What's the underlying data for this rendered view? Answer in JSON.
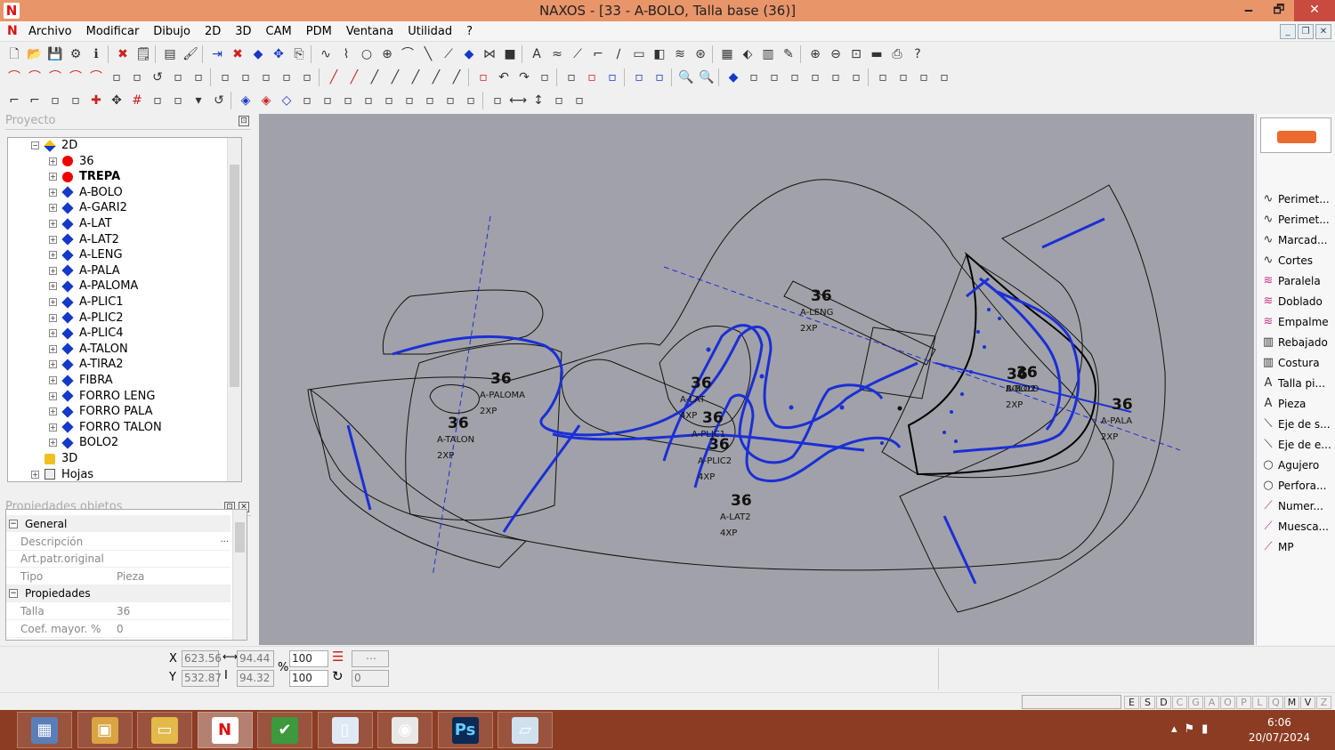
{
  "window": {
    "title": "NAXOS - [33 - A-BOLO, Talla base (36)]",
    "minimize": "🗕",
    "maximize": "🗗",
    "close": "✕"
  },
  "menu": [
    "Archivo",
    "Modificar",
    "Dibujo",
    "2D",
    "3D",
    "CAM",
    "PDM",
    "Ventana",
    "Utilidad",
    "?"
  ],
  "toolbar_icons": {
    "row1": [
      "new-file",
      "open-folder",
      "save",
      "gear",
      "info",
      "sep",
      "delete",
      "props",
      "sep",
      "layers",
      "color-picker",
      "sep",
      "insert",
      "delete-red",
      "mark",
      "move",
      "copy",
      "sep",
      "curve",
      "spline",
      "circle",
      "target",
      "arc",
      "line",
      "polyline",
      "point",
      "mirror",
      "square",
      "sep",
      "text",
      "wave",
      "measure",
      "corner",
      "slash",
      "rect",
      "bucket",
      "waves",
      "node",
      "sep",
      "piece",
      "arrange",
      "fill",
      "pin",
      "sep",
      "zoom-in",
      "zoom-out",
      "zoom-window",
      "ruler",
      "print",
      "help"
    ],
    "row2": [
      "arc1",
      "arc2",
      "arc3",
      "arc4",
      "arc5",
      "ellipse",
      "notch",
      "rotate",
      "dots",
      "grid",
      "sep",
      "copy2",
      "paste",
      "cut",
      "select",
      "arrows",
      "sep",
      "line-a",
      "line-b",
      "line-c",
      "line-d",
      "line-e",
      "line-f",
      "line-g",
      "sep",
      "cross",
      "undo-arrow",
      "redo-arrow",
      "wave2",
      "sep",
      "box",
      "scissors",
      "up-down",
      "sep",
      "arrow-r",
      "arrow-r2",
      "sep",
      "zoom-a",
      "zoom-b",
      "sep",
      "diamond",
      "slash2",
      "stack",
      "folder",
      "image",
      "shape",
      "shape2",
      "sep",
      "image2",
      "badge",
      "flip",
      "flip2"
    ],
    "row3": [
      "corner1",
      "corner2",
      "rect-a",
      "dotted-line",
      "cross-red",
      "move4",
      "hash-red",
      "align",
      "curve2",
      "dropdown",
      "rotate",
      "sep",
      "merge",
      "merge-red",
      "split",
      "pages",
      "down",
      "bars",
      "columns",
      "link",
      "chart",
      "chart2",
      "window",
      "asterisk",
      "sep",
      "measure2",
      "h-arrows",
      "v-arrows",
      "pointer",
      "compass"
    ]
  },
  "project_panel": {
    "title": "Proyecto",
    "pin": "⊡",
    "tree": [
      {
        "label": "2D",
        "level": 0,
        "marker": "yellow-diamond",
        "expand": "−"
      },
      {
        "label": "36",
        "level": 1,
        "marker": "red-dot",
        "expand": "+"
      },
      {
        "label": "TREPA",
        "level": 1,
        "marker": "red-dot",
        "expand": "+",
        "bold": true
      },
      {
        "label": "A-BOLO",
        "level": 1,
        "marker": "blue-diamond",
        "expand": "+"
      },
      {
        "label": "A-GARI2",
        "level": 1,
        "marker": "blue-diamond",
        "expand": "+"
      },
      {
        "label": "A-LAT",
        "level": 1,
        "marker": "blue-diamond",
        "expand": "+"
      },
      {
        "label": "A-LAT2",
        "level": 1,
        "marker": "blue-diamond",
        "expand": "+"
      },
      {
        "label": "A-LENG",
        "level": 1,
        "marker": "blue-diamond",
        "expand": "+"
      },
      {
        "label": "A-PALA",
        "level": 1,
        "marker": "blue-diamond",
        "expand": "+"
      },
      {
        "label": "A-PALOMA",
        "level": 1,
        "marker": "blue-diamond",
        "expand": "+"
      },
      {
        "label": "A-PLIC1",
        "level": 1,
        "marker": "blue-diamond",
        "expand": "+"
      },
      {
        "label": "A-PLIC2",
        "level": 1,
        "marker": "blue-diamond",
        "expand": "+"
      },
      {
        "label": "A-PLIC4",
        "level": 1,
        "marker": "blue-diamond",
        "expand": "+"
      },
      {
        "label": "A-TALON",
        "level": 1,
        "marker": "blue-diamond",
        "expand": "+"
      },
      {
        "label": "A-TIRA2",
        "level": 1,
        "marker": "blue-diamond",
        "expand": "+"
      },
      {
        "label": "FIBRA",
        "level": 1,
        "marker": "blue-diamond",
        "expand": "+"
      },
      {
        "label": "FORRO LENG",
        "level": 1,
        "marker": "blue-diamond",
        "expand": "+"
      },
      {
        "label": "FORRO PALA",
        "level": 1,
        "marker": "blue-diamond",
        "expand": "+"
      },
      {
        "label": "FORRO TALON",
        "level": 1,
        "marker": "blue-diamond",
        "expand": "+"
      },
      {
        "label": "BOLO2",
        "level": 1,
        "marker": "blue-diamond",
        "expand": "+"
      },
      {
        "label": "3D",
        "level": 0,
        "marker": "yellow-cube",
        "expand": ""
      },
      {
        "label": "Hojas",
        "level": 0,
        "marker": "sheets",
        "expand": "+"
      }
    ]
  },
  "properties_panel": {
    "title": "Propiedades objetos",
    "sections": [
      {
        "label": "General",
        "expand": "−",
        "rows": [
          {
            "key": "Descripción",
            "value": "",
            "button": "..."
          },
          {
            "key": "Art.patr.original",
            "value": ""
          },
          {
            "key": "Tipo",
            "value": "Pieza"
          }
        ]
      },
      {
        "label": "Propiedades",
        "expand": "−",
        "rows": [
          {
            "key": "Talla",
            "value": "36"
          },
          {
            "key": "Coef. mayor. %",
            "value": "0"
          }
        ]
      }
    ]
  },
  "canvas": {
    "background": "#a1a1a9",
    "outline_color": "#111111",
    "seam_color": "#1a2fd6",
    "labels": [
      {
        "size": "36",
        "name": "A-PALOMA",
        "qty": "2XP"
      },
      {
        "size": "36",
        "name": "A-TALON",
        "qty": "2XP"
      },
      {
        "size": "36",
        "name": "A-LAT",
        "qty": "4XP"
      },
      {
        "size": "36",
        "name": "A-PLIC1",
        "qty": ""
      },
      {
        "size": "36",
        "name": "A-PLIC2",
        "qty": "4XP"
      },
      {
        "size": "36",
        "name": "A-LENG",
        "qty": "2XP"
      },
      {
        "size": "36",
        "name": "A-BOLO",
        "qty": "2XP"
      },
      {
        "size": "36",
        "name": "BOLO2",
        "qty": ""
      },
      {
        "size": "36",
        "name": "A-PALA",
        "qty": "2XP"
      },
      {
        "size": "36",
        "name": "A-LAT2",
        "qty": "4XP"
      },
      {
        "size": "36",
        "name": "",
        "qty": ""
      }
    ]
  },
  "right_panel": {
    "tools": [
      {
        "icon": "curve",
        "label": "Perimet..."
      },
      {
        "icon": "curve",
        "label": "Perimet..."
      },
      {
        "icon": "curve",
        "label": "Marcad..."
      },
      {
        "icon": "curve",
        "label": "Cortes"
      },
      {
        "icon": "double-curve",
        "label": "Paralela"
      },
      {
        "icon": "double-curve",
        "label": "Doblado"
      },
      {
        "icon": "double-curve",
        "label": "Empalme"
      },
      {
        "icon": "stitch",
        "label": "Rebajado"
      },
      {
        "icon": "stitch",
        "label": "Costura"
      },
      {
        "icon": "letter-a",
        "label": "Talla pi..."
      },
      {
        "icon": "letter-a",
        "label": "Pieza"
      },
      {
        "icon": "diagonal",
        "label": "Eje de s..."
      },
      {
        "icon": "diagonal",
        "label": "Eje de e..."
      },
      {
        "icon": "circle",
        "label": "Agujero"
      },
      {
        "icon": "circle",
        "label": "Perfora..."
      },
      {
        "icon": "pen",
        "label": "Numer..."
      },
      {
        "icon": "pen",
        "label": "Muesca..."
      },
      {
        "icon": "pen",
        "label": "MP"
      }
    ]
  },
  "coords": {
    "x_label": "X",
    "y_label": "Y",
    "x": "623.56",
    "y": "532.87",
    "w": "94.44",
    "h": "94.32",
    "scale_x": "100",
    "scale_y": "100",
    "percent": "%",
    "rotation": "0"
  },
  "status_flags": [
    "E",
    "S",
    "D",
    "C",
    "G",
    "A",
    "O",
    "P",
    "L",
    "Q",
    "M",
    "V",
    "Z"
  ],
  "status_flags_on": [
    "E",
    "S",
    "D",
    "M",
    "V"
  ],
  "taskbar": {
    "apps": [
      "calculator",
      "explorer",
      "files",
      "naxos",
      "green-app",
      "document",
      "chrome",
      "photoshop",
      "notepad"
    ],
    "active": "naxos",
    "ps_label": "Ps",
    "naxos_label": "N",
    "time": "6:06",
    "date": "20/07/2024"
  }
}
